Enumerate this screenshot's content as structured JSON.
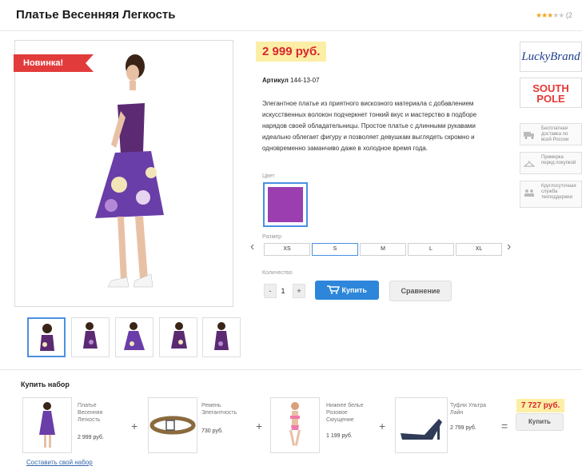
{
  "product": {
    "title": "Платье Весенняя Легкость",
    "rating": {
      "stars_filled": 3,
      "stars_total": 5,
      "count_label": "(2"
    },
    "badge": "Новинка!",
    "price": "2 999 руб.",
    "sku_label": "Артикул",
    "sku_value": "144-13-07",
    "description": "Элегантное платье из приятного вискозного материала с добавлением искусственных волокон подчеркнет тонкий вкус и мастерство в подборе нарядов своей обладательницы. Простое платье с длинными рукавами идеально облегает фигуру и позволяет девушкам выглядеть скромно и одновременно заманчиво даже в холодное время года.",
    "color_label": "Цвет",
    "color_hex": "#9b3fb0",
    "size_label": "Размер",
    "sizes": [
      "XS",
      "S",
      "M",
      "L",
      "XL"
    ],
    "selected_size": "S",
    "qty_label": "Количество",
    "qty_value": "1",
    "minus": "-",
    "plus": "+",
    "buy_label": "Купить",
    "compare_label": "Сравнение"
  },
  "brands": {
    "lucky": "LuckyBrand",
    "south_1": "SOUTH",
    "south_2": "POLE"
  },
  "services": [
    {
      "text": "Бесплатная\nдоставка по\nвсей России",
      "icon": "truck-icon"
    },
    {
      "text": "Примерка\nперед покупкой",
      "icon": "hanger-icon"
    },
    {
      "text": "Круглосуточная\nслужба\nтехподдержки",
      "icon": "support-icon"
    }
  ],
  "set": {
    "title": "Купить набор",
    "items": [
      {
        "name": "Платье\nВесенняя\nЛегкость",
        "price": "2 999 руб."
      },
      {
        "name": "Ремень\nЭлегантность",
        "price": "730 руб."
      },
      {
        "name": "Нижнее белье\nРозовое\nСмущение",
        "price": "1 199 руб."
      },
      {
        "name": "Туфли Ультра\nЛайн",
        "price": "2 799 руб."
      }
    ],
    "plus": "+",
    "equals": "=",
    "total": "7 727 руб.",
    "buy_label": "Купить",
    "compose_link": "Составить свой набор"
  },
  "colors": {
    "accent": "#2d86d9",
    "price_red": "#d8262e",
    "price_bg": "#fdeea5",
    "badge": "#e23b3b"
  }
}
